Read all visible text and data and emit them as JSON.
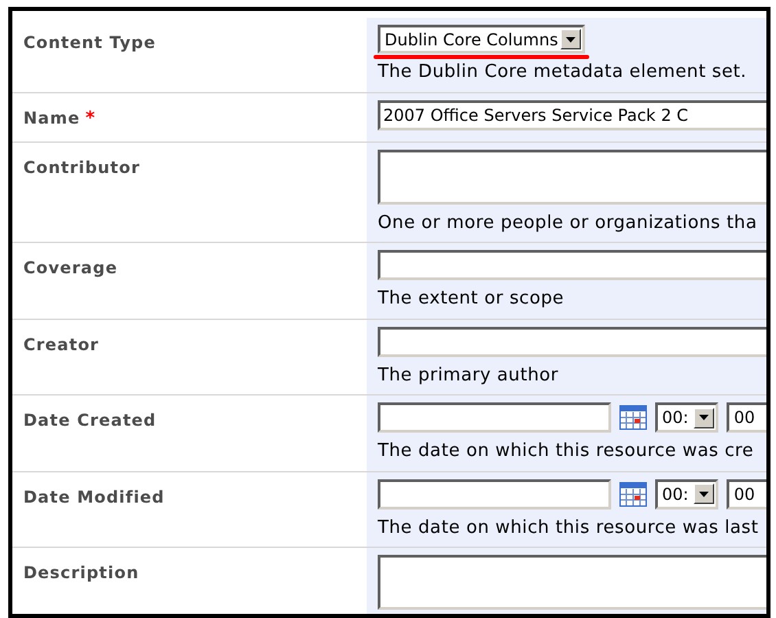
{
  "fields": [
    {
      "label": "Content Type",
      "kind": "select",
      "value": "Dublin Core Columns",
      "annotated": true,
      "help": "The Dublin Core metadata element set."
    },
    {
      "label": "Name",
      "kind": "text",
      "marker": "*",
      "value": "2007 Office Servers Service Pack 2 C"
    },
    {
      "label": "Contributor",
      "kind": "textarea",
      "help": "One or more people or organizations tha"
    },
    {
      "label": "Coverage",
      "kind": "text",
      "help": "The extent or scope"
    },
    {
      "label": "Creator",
      "kind": "text",
      "help": "The primary author"
    },
    {
      "label": "Date Created",
      "kind": "datetime",
      "hour": "00:",
      "minute": "00",
      "help": "The date on which this resource was cre"
    },
    {
      "label": "Date Modified",
      "kind": "datetime",
      "hour": "00:",
      "minute": "00",
      "help": "The date on which this resource was last"
    },
    {
      "label": "Description",
      "kind": "textarea"
    }
  ]
}
